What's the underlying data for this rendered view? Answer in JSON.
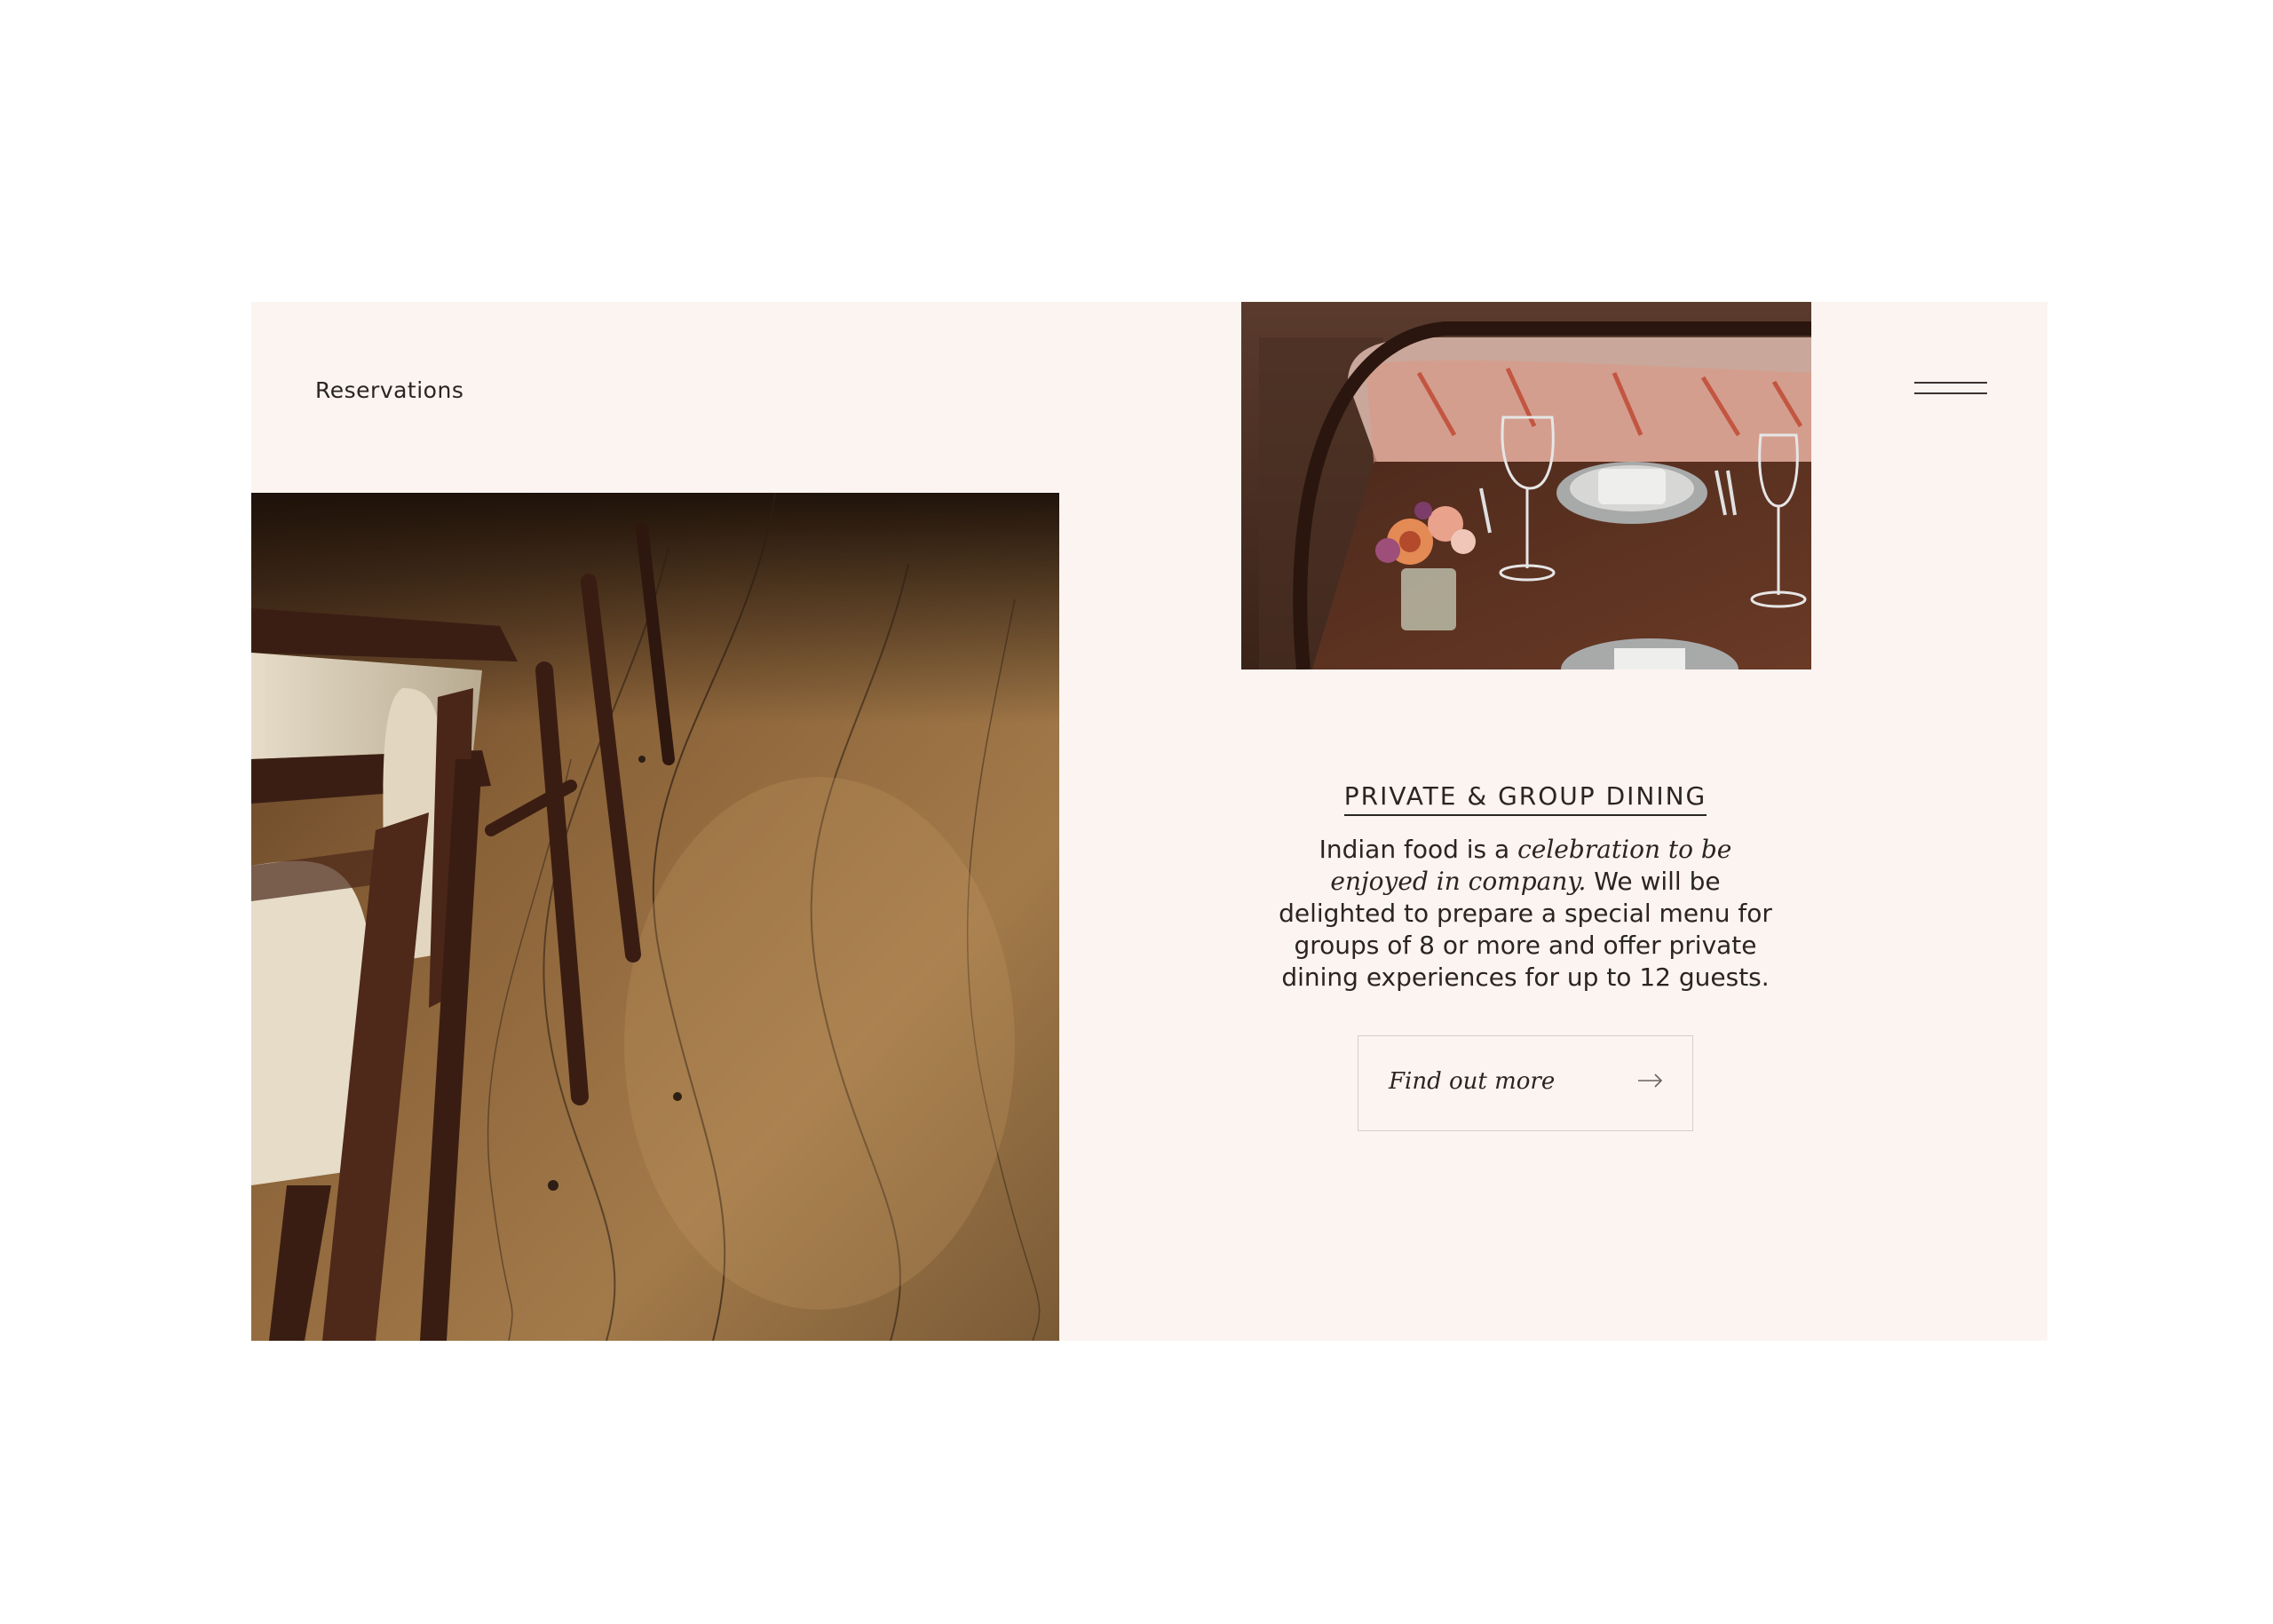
{
  "header": {
    "reservations_label": "Reservations",
    "menu_icon": "hamburger-menu-icon"
  },
  "section": {
    "title": "PRIVATE & GROUP DINING",
    "description": {
      "part1": "Indian food is a ",
      "emphasis": "celebration to be enjoyed in company.",
      "part2": " We will be delighted to prepare a special menu for groups of 8 or more and offer private dining experiences for up to 12 guests."
    },
    "cta_label": "Find out more",
    "cta_icon": "arrow-right-icon"
  },
  "images": {
    "left": "restaurant-chairs-wooden-floor-photo",
    "right": "table-setting-with-flowers-photo"
  },
  "colors": {
    "panel_background": "#fbf4f1",
    "text": "#2a2522",
    "button_border": "#d8cdc9"
  }
}
